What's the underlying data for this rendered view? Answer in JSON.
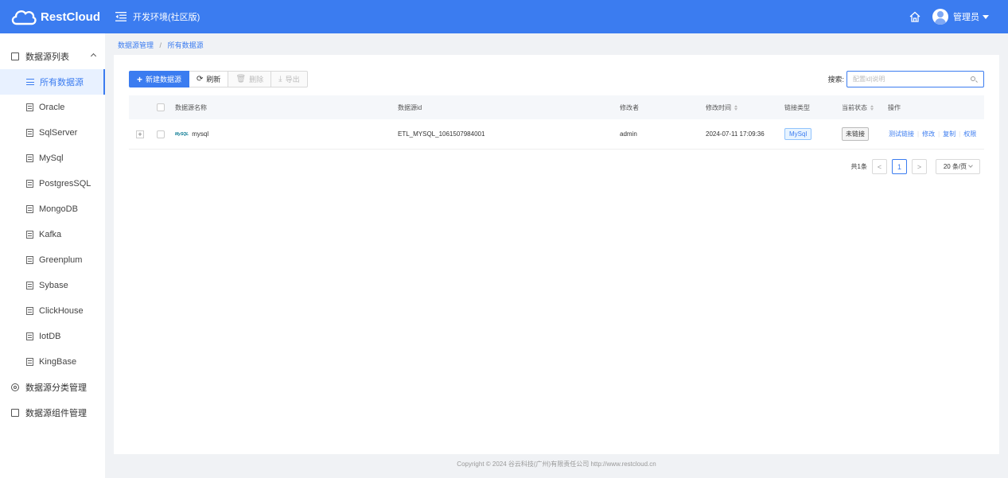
{
  "header": {
    "logo_text": "RestCloud",
    "env_title": "开发环境(社区版)",
    "user_name": "管理员",
    "brand_color": "#3b7cf0"
  },
  "sidebar": {
    "group_label": "数据源列表",
    "items": [
      {
        "label": "所有数据源",
        "active": true
      },
      {
        "label": "Oracle"
      },
      {
        "label": "SqlServer"
      },
      {
        "label": "MySql"
      },
      {
        "label": "PostgresSQL"
      },
      {
        "label": "MongoDB"
      },
      {
        "label": "Kafka"
      },
      {
        "label": "Greenplum"
      },
      {
        "label": "Sybase"
      },
      {
        "label": "ClickHouse"
      },
      {
        "label": "IotDB"
      },
      {
        "label": "KingBase"
      }
    ],
    "category_manage": "数据源分类管理",
    "component_manage": "数据源组件管理"
  },
  "breadcrumb": {
    "parent": "数据源管理",
    "separator": "/",
    "current": "所有数据源"
  },
  "toolbar": {
    "new_label": "新建数据源",
    "refresh_label": "刷新",
    "delete_label": "删除",
    "export_label": "导出"
  },
  "search": {
    "label": "搜索:",
    "placeholder": "配置id|说明"
  },
  "table": {
    "columns": {
      "name": "数据源名称",
      "id": "数据源id",
      "modifier": "修改者",
      "modified_time": "修改时间",
      "link_type": "链接类型",
      "status": "当前状态",
      "actions": "操作"
    },
    "rows": [
      {
        "expand": "+",
        "logo": "MySQL",
        "name": "mysql",
        "id": "ETL_MYSQL_1061507984001",
        "modifier": "admin",
        "modified_time": "2024-07-11 17:09:36",
        "link_type": "MySql",
        "status": "未链接",
        "actions": [
          "测试链接",
          "修改",
          "复制",
          "权限"
        ]
      }
    ]
  },
  "pagination": {
    "total": "共1条",
    "prev": "<",
    "current_page": "1",
    "next": ">",
    "page_size": "20 条/页"
  },
  "footer": {
    "text": "Copyright © 2024   谷云科技(广州)有限责任公司   http://www.restcloud.cn"
  }
}
